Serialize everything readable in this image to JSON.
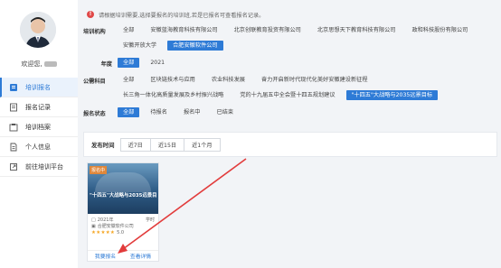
{
  "sidebar": {
    "welcome": "欢迎您,",
    "items": [
      {
        "label": "培训报名",
        "icon": "book-icon"
      },
      {
        "label": "报名记录",
        "icon": "record-icon"
      },
      {
        "label": "培训档案",
        "icon": "archive-icon"
      },
      {
        "label": "个人信息",
        "icon": "document-icon"
      },
      {
        "label": "前往培训平台",
        "icon": "external-link-icon"
      }
    ]
  },
  "notice": "请根据培训需要,选择要报名的培训班,若是已报名可查看报名记录。",
  "filters": {
    "institution": {
      "label": "培训机构",
      "options": [
        "全部",
        "安徽蓝海教育科技有限公司",
        "北京创联教育投资有限公司",
        "北京思想天下教育科技有限公司",
        "政和科技股份有限公司",
        "安徽开放大学",
        "合肥安徽软件公司"
      ],
      "selected": "合肥安徽软件公司"
    },
    "year": {
      "label": "年度",
      "options": [
        "全部",
        "2021"
      ],
      "selected": "全部"
    },
    "subject": {
      "label": "公需科目",
      "options": [
        "全部",
        "区块链技术与应用",
        "农业科技发展",
        "奋力开启新时代现代化美好安徽建设新征程",
        "长三角一体化高质量发展及乡村振兴战略",
        "党的十九届五中全会暨十四五规划建议",
        "\"十四五\"大战略与2035远景目标"
      ],
      "selected": "\"十四五\"大战略与2035远景目标"
    },
    "status": {
      "label": "报名状态",
      "options": [
        "全部",
        "待报名",
        "报名中",
        "已结束"
      ],
      "selected": "全部"
    }
  },
  "sort": {
    "label": "发布时间",
    "options": [
      "近7日",
      "近15日",
      "近1个月"
    ]
  },
  "card": {
    "badge": "报名中",
    "title": "\"十四五\"大战略与2035远景目标",
    "year": "2021年",
    "hours": "学时",
    "org": "合肥安徽软件公司",
    "rating": "5.0",
    "stars": "★★★★★",
    "enroll_label": "我要报名",
    "detail_label": "查看详情"
  },
  "colors": {
    "accent": "#2e7bd6",
    "badge": "#e0873a",
    "arrow": "#e23c3c"
  }
}
